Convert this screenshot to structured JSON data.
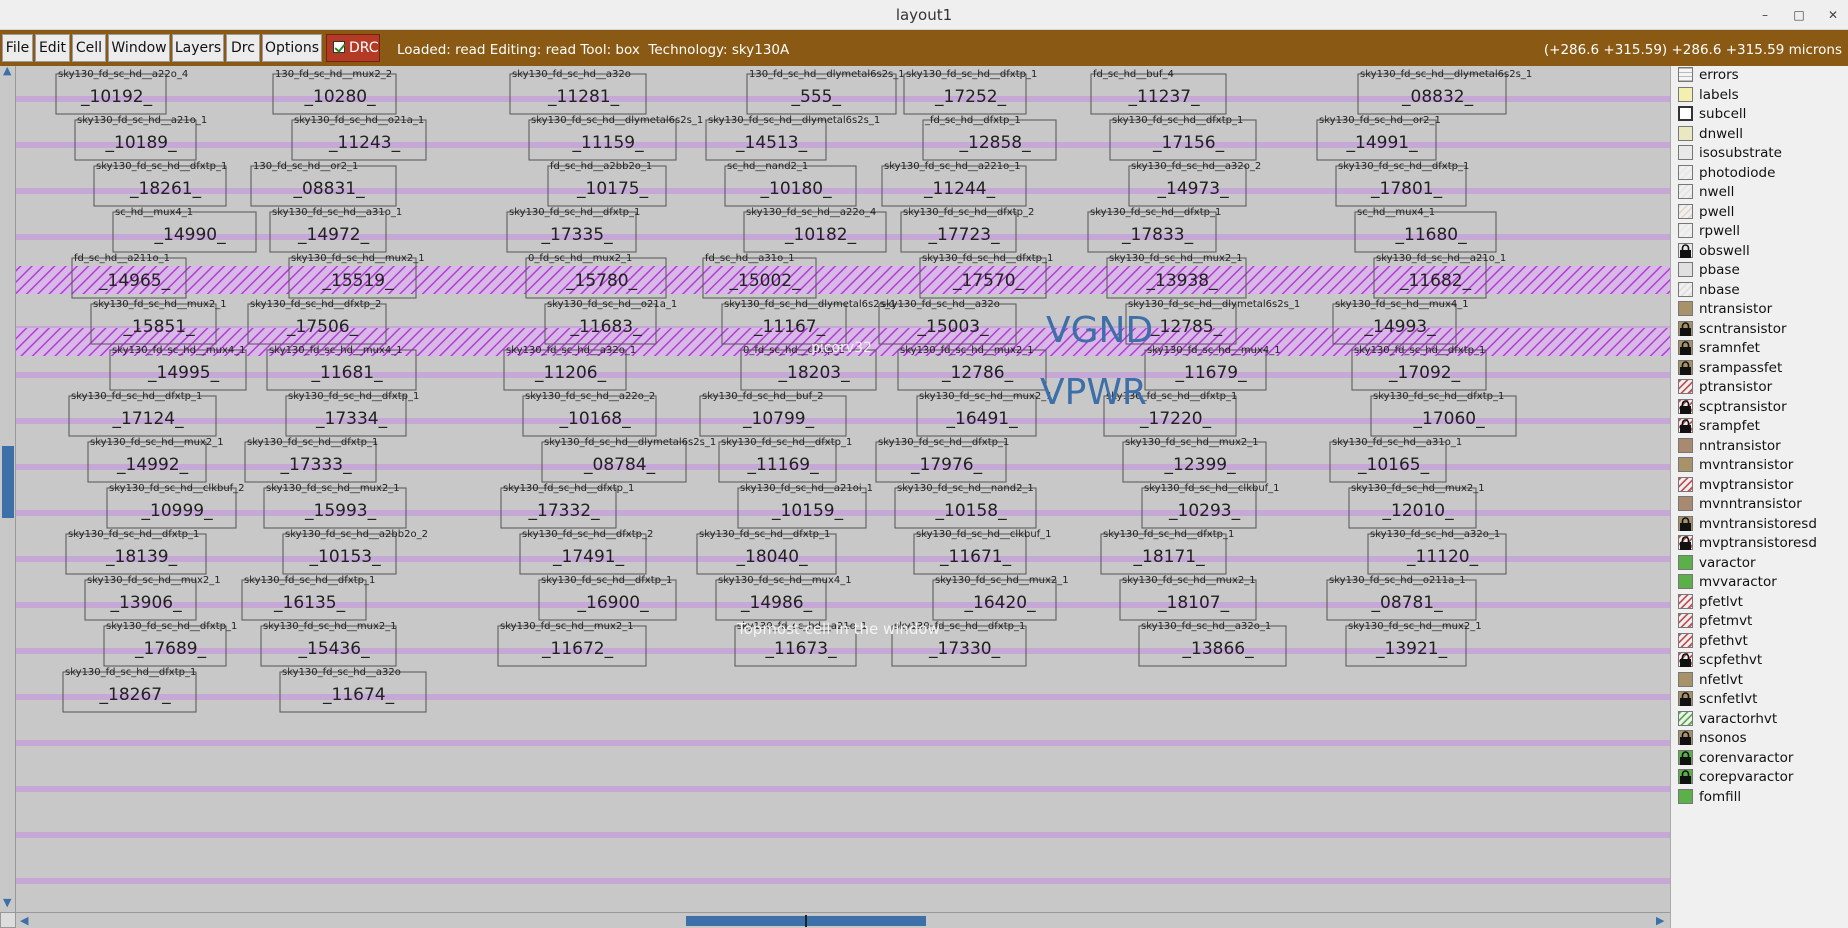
{
  "window": {
    "title": "layout1",
    "controls": [
      "–",
      "□",
      "✕"
    ]
  },
  "menubar": {
    "items": [
      "File",
      "Edit",
      "Cell",
      "Window",
      "Layers",
      "Drc",
      "Options"
    ],
    "drc_toggle": {
      "label": "DRC",
      "checked": true
    },
    "status": "Loaded: read Editing: read Tool: box  Technology: sky130A",
    "coords": "(+286.6 +315.59) +286.6 +315.59 microns",
    "bar_color": "#8a5a14"
  },
  "canvas": {
    "net_labels": [
      "VGND",
      "VPWR"
    ],
    "cell_name": "picorv32",
    "message": "Topmost cell in the window",
    "label_color": "#3d6fa8"
  },
  "cells": [
    {
      "t": "sky130_fd_sc_hd__a22o_4",
      "n": "_10192_"
    },
    {
      "t": "130_fd_sc_hd__mux2_2",
      "n": "_10280_"
    },
    {
      "t": "sky130_fd_sc_hd__a32o",
      "n": "_11281_"
    },
    {
      "t": "130_fd_sc_hd__dlymetal6s2s_1",
      "n": "_555_"
    },
    {
      "t": "sky130_fd_sc_hd__dfxtp_1",
      "n": "_17252_"
    },
    {
      "t": "fd_sc_hd__buf_4",
      "n": "_11237_"
    },
    {
      "t": "sky130_fd_sc_hd__dlymetal6s2s_1",
      "n": "_08832_"
    },
    {
      "t": "sky130_fd_sc_hd__a21o_1",
      "n": "_10189_"
    },
    {
      "t": "sky130_fd_sc_hd__o21a_1",
      "n": "_11243_"
    },
    {
      "t": "sky130_fd_sc_hd__dlymetal6s2s_1",
      "n": "_11159_"
    },
    {
      "t": "sky130_fd_sc_hd__dlymetal6s2s_1",
      "n": "_14513_"
    },
    {
      "t": "_fd_sc_hd__dfxtp_1",
      "n": "_12858_"
    },
    {
      "t": "sky130_fd_sc_hd__dfxtp_1",
      "n": "_17156_"
    },
    {
      "t": "sky130_fd_sc_hd__or2_1",
      "n": "_14991_"
    },
    {
      "t": "sky130_fd_sc_hd__dfxtp_1",
      "n": "_18261_"
    },
    {
      "t": "130_fd_sc_hd__or2_1",
      "n": "_08831_"
    },
    {
      "t": "fd_sc_hd__a2bb2o_1",
      "n": "_10175_"
    },
    {
      "t": "sc_hd__nand2_1",
      "n": "_10180_"
    },
    {
      "t": "sky130_fd_sc_hd__a221o_1",
      "n": "_11244_"
    },
    {
      "t": "sky130_fd_sc_hd__a32o_2",
      "n": "_14973_"
    },
    {
      "t": "sky130_fd_sc_hd__dfxtp_1",
      "n": "_17801_"
    },
    {
      "t": "sc_hd__mux4_1",
      "n": "_14990_"
    },
    {
      "t": "sky130_fd_sc_hd__a31o_1",
      "n": "_14972_"
    },
    {
      "t": "sky130_fd_sc_hd__dfxtp_1",
      "n": "_17335_"
    },
    {
      "t": "sky130_fd_sc_hd__a22o_4",
      "n": "_10182_"
    },
    {
      "t": "sky130_fd_sc_hd__dfxtp_2",
      "n": "_17723_"
    },
    {
      "t": "sky130_fd_sc_hd__dfxtp_1",
      "n": "_17833_"
    },
    {
      "t": "sc_hd__mux4_1",
      "n": "_11680_"
    },
    {
      "t": "fd_sc_hd__a211o_1",
      "n": "_14965_"
    },
    {
      "t": "sky130_fd_sc_hd__mux2_1",
      "n": "_15519_"
    },
    {
      "t": "0_fd_sc_hd__mux2_1",
      "n": "_15780_"
    },
    {
      "t": "fd_sc_hd__a31o_1",
      "n": "_15002_"
    },
    {
      "t": "sky130_fd_sc_hd__dfxtp_1",
      "n": "_17570_"
    },
    {
      "t": "sky130_fd_sc_hd__mux2_1",
      "n": "_13938_"
    },
    {
      "t": "sky130_fd_sc_hd__a21o_1",
      "n": "_11682_"
    },
    {
      "t": "sky130_fd_sc_hd__mux2_1",
      "n": "_15851_"
    },
    {
      "t": "sky130_fd_sc_hd__dfxtp_2",
      "n": "_17506_"
    },
    {
      "t": "sky130_fd_sc_hd__o21a_1",
      "n": "_11683_"
    },
    {
      "t": "sky130_fd_sc_hd__dlymetal6s2s_1",
      "n": "_11167_"
    },
    {
      "t": "sky130_fd_sc_hd__a32o",
      "n": "_15003_"
    },
    {
      "t": "sky130_fd_sc_hd__dlymetal6s2s_1",
      "n": "_12785_"
    },
    {
      "t": "sky130_fd_sc_hd__mux4_1",
      "n": "_14993_"
    },
    {
      "t": "sky130_fd_sc_hd__mux4_1",
      "n": "_14995_"
    },
    {
      "t": "sky130_fd_sc_hd__mux4_1",
      "n": "_11681_"
    },
    {
      "t": "sky130_fd_sc_hd__a32o_1",
      "n": "_11206_"
    },
    {
      "t": "0_fd_sc_hd__dfxtp_1",
      "n": "_18203_"
    },
    {
      "t": "sky130_fd_sc_hd__mux2_1",
      "n": "_12786_"
    },
    {
      "t": "sky130_fd_sc_hd__mux4_1",
      "n": "_11679_"
    },
    {
      "t": "sky130_fd_sc_hd__dfxtp_1",
      "n": "_17092_"
    },
    {
      "t": "sky130_fd_sc_hd__dfxtp_1",
      "n": "_17124_"
    },
    {
      "t": "sky130_fd_sc_hd__dfxtp_1",
      "n": "_17334_"
    },
    {
      "t": "sky130_fd_sc_hd__a22o_2",
      "n": "_10168_"
    },
    {
      "t": "sky130_fd_sc_hd__buf_2",
      "n": "_10799_"
    },
    {
      "t": "sky130_fd_sc_hd__mux2_1",
      "n": "_16491_"
    },
    {
      "t": "sky130_fd_sc_hd__dfxtp_1",
      "n": "_17220_"
    },
    {
      "t": "sky130_fd_sc_hd__dfxtp_1",
      "n": "_17060_"
    },
    {
      "t": "sky130_fd_sc_hd__mux2_1",
      "n": "_14992_"
    },
    {
      "t": "sky130_fd_sc_hd__dfxtp_1",
      "n": "_17333_"
    },
    {
      "t": "sky130_fd_sc_hd__dlymetal6s2s_1",
      "n": "_08784_"
    },
    {
      "t": "sky130_fd_sc_hd__dfxtp_1",
      "n": "_11169_"
    },
    {
      "t": "sky130_fd_sc_hd__dfxtp_1",
      "n": "_17976_"
    },
    {
      "t": "sky130_fd_sc_hd__mux2_1",
      "n": "_12399_"
    },
    {
      "t": "sky130_fd_sc_hd__a31o_1",
      "n": "_10165_"
    },
    {
      "t": "sky130_fd_sc_hd__clkbuf_2",
      "n": "_10999_"
    },
    {
      "t": "sky130_fd_sc_hd__mux2_1",
      "n": "_15993_"
    },
    {
      "t": "sky130_fd_sc_hd__dfxtp_1",
      "n": "_17332_"
    },
    {
      "t": "sky130_fd_sc_hd__a21oi_1",
      "n": "_10159_"
    },
    {
      "t": "sky130_fd_sc_hd__nand2_1",
      "n": "_10158_"
    },
    {
      "t": "sky130_fd_sc_hd__clkbuf_1",
      "n": "_10293_"
    },
    {
      "t": "sky130_fd_sc_hd__mux2_1",
      "n": "_12010_"
    },
    {
      "t": "sky130_fd_sc_hd__dfxtp_1",
      "n": "_18139_"
    },
    {
      "t": "sky130_fd_sc_hd__a2bb2o_2",
      "n": "_10153_"
    },
    {
      "t": "sky130_fd_sc_hd__dfxtp_2",
      "n": "_17491_"
    },
    {
      "t": "sky130_fd_sc_hd__dfxtp_1",
      "n": "_18040_"
    },
    {
      "t": "sky130_fd_sc_hd__clkbuf_1",
      "n": "_11671_"
    },
    {
      "t": "sky130_fd_sc_hd__dfxtp_1",
      "n": "_18171_"
    },
    {
      "t": "sky130_fd_sc_hd__a32o_1",
      "n": "_11120_"
    },
    {
      "t": "sky130_fd_sc_hd__mux2_1",
      "n": "_13906_"
    },
    {
      "t": "sky130_fd_sc_hd__dfxtp_1",
      "n": "_16135_"
    },
    {
      "t": "sky130_fd_sc_hd__dfxtp_1",
      "n": "_16900_"
    },
    {
      "t": "sky130_fd_sc_hd__mux4_1",
      "n": "_14986_"
    },
    {
      "t": "sky130_fd_sc_hd__mux2_1",
      "n": "_16420_"
    },
    {
      "t": "sky130_fd_sc_hd__mux2_1",
      "n": "_18107_"
    },
    {
      "t": "sky130_fd_sc_hd__o211a_1",
      "n": "_08781_"
    },
    {
      "t": "sky130_fd_sc_hd__dfxtp_1",
      "n": "_17689_"
    },
    {
      "t": "sky130_fd_sc_hd__mux2_1",
      "n": "_15436_"
    },
    {
      "t": "sky130_fd_sc_hd__mux2_1",
      "n": "_11672_"
    },
    {
      "t": "sky130_fd_sc_hd__a21o_1",
      "n": "_11673_"
    },
    {
      "t": "sky130_fd_sc_hd__dfxtp_1",
      "n": "_17330_"
    },
    {
      "t": "sky130_fd_sc_hd__a32o_1",
      "n": "_13866_"
    },
    {
      "t": "sky130_fd_sc_hd__mux2_1",
      "n": "_13921_"
    },
    {
      "t": "sky130_fd_sc_hd__dfxtp_1",
      "n": "_18267_"
    },
    {
      "t": "sky130_fd_sc_hd__a32o",
      "n": "_11674_"
    }
  ],
  "layers": [
    {
      "name": "errors",
      "color": "#f5f5f5",
      "pattern": "grid",
      "locked": false
    },
    {
      "name": "labels",
      "color": "#f3efb0",
      "pattern": "solid",
      "locked": false
    },
    {
      "name": "subcell",
      "color": "#ffffff",
      "pattern": "outline",
      "locked": false
    },
    {
      "name": "dnwell",
      "color": "#e9e8c0",
      "pattern": "solid",
      "locked": false
    },
    {
      "name": "isosubstrate",
      "color": "#e9e9e9",
      "pattern": "solid",
      "locked": false
    },
    {
      "name": "photodiode",
      "color": "#e8e8e8",
      "pattern": "hatch",
      "locked": false
    },
    {
      "name": "nwell",
      "color": "#e3e3e3",
      "pattern": "hatch",
      "locked": false
    },
    {
      "name": "pwell",
      "color": "#e4d8cc",
      "pattern": "hatch",
      "locked": false
    },
    {
      "name": "rpwell",
      "color": "#e8e8e8",
      "pattern": "hatch",
      "locked": false
    },
    {
      "name": "obswell",
      "color": "#e8e8e8",
      "pattern": "solid",
      "locked": true
    },
    {
      "name": "pbase",
      "color": "#e0e0e0",
      "pattern": "solid",
      "locked": false
    },
    {
      "name": "nbase",
      "color": "#e0e0e0",
      "pattern": "hatch",
      "locked": false
    },
    {
      "name": "ntransistor",
      "color": "#a8926a",
      "pattern": "solid",
      "locked": false
    },
    {
      "name": "scntransistor",
      "color": "#a8926a",
      "pattern": "solid",
      "locked": true
    },
    {
      "name": "sramnfet",
      "color": "#a8926a",
      "pattern": "solid",
      "locked": true
    },
    {
      "name": "srampassfet",
      "color": "#a8926a",
      "pattern": "solid",
      "locked": true
    },
    {
      "name": "ptransistor",
      "color": "#c0565a",
      "pattern": "hatch",
      "locked": false
    },
    {
      "name": "scptransistor",
      "color": "#c0565a",
      "pattern": "hatch",
      "locked": true
    },
    {
      "name": "srampfet",
      "color": "#c0565a",
      "pattern": "hatch",
      "locked": true
    },
    {
      "name": "nntransistor",
      "color": "#a88a70",
      "pattern": "solid",
      "locked": false
    },
    {
      "name": "mvntransistor",
      "color": "#a8926a",
      "pattern": "solid",
      "locked": false
    },
    {
      "name": "mvptransistor",
      "color": "#c0565a",
      "pattern": "hatch",
      "locked": false
    },
    {
      "name": "mvnntransistor",
      "color": "#a88a70",
      "pattern": "solid",
      "locked": false
    },
    {
      "name": "mvntransistoresd",
      "color": "#a8926a",
      "pattern": "solid",
      "locked": true
    },
    {
      "name": "mvptransistoresd",
      "color": "#c0565a",
      "pattern": "hatch",
      "locked": true
    },
    {
      "name": "varactor",
      "color": "#5cb04a",
      "pattern": "solid",
      "locked": false
    },
    {
      "name": "mvvaractor",
      "color": "#5cb04a",
      "pattern": "solid",
      "locked": false
    },
    {
      "name": "pfetlvt",
      "color": "#c0565a",
      "pattern": "hatch",
      "locked": false
    },
    {
      "name": "pfetmvt",
      "color": "#c0565a",
      "pattern": "hatch",
      "locked": false
    },
    {
      "name": "pfethvt",
      "color": "#c0565a",
      "pattern": "hatch",
      "locked": false
    },
    {
      "name": "scpfethvt",
      "color": "#c0565a",
      "pattern": "hatch",
      "locked": true
    },
    {
      "name": "nfetlvt",
      "color": "#a8926a",
      "pattern": "solid",
      "locked": false
    },
    {
      "name": "scnfetlvt",
      "color": "#a8926a",
      "pattern": "solid",
      "locked": true
    },
    {
      "name": "varactorhvt",
      "color": "#5cb04a",
      "pattern": "hatch",
      "locked": false
    },
    {
      "name": "nsonos",
      "color": "#a8926a",
      "pattern": "solid",
      "locked": true
    },
    {
      "name": "corenvaractor",
      "color": "#5cb04a",
      "pattern": "solid",
      "locked": true
    },
    {
      "name": "corepvaractor",
      "color": "#5cb04a",
      "pattern": "solid",
      "locked": true
    },
    {
      "name": "fomfill",
      "color": "#5cb04a",
      "pattern": "solid",
      "locked": false
    }
  ],
  "colors": {
    "canvas_bg": "#c8c8c8",
    "rail_band": "#c5a8d6",
    "power_rail_hatch": "#b040d0",
    "scroll_accent": "#3d6fa8"
  }
}
